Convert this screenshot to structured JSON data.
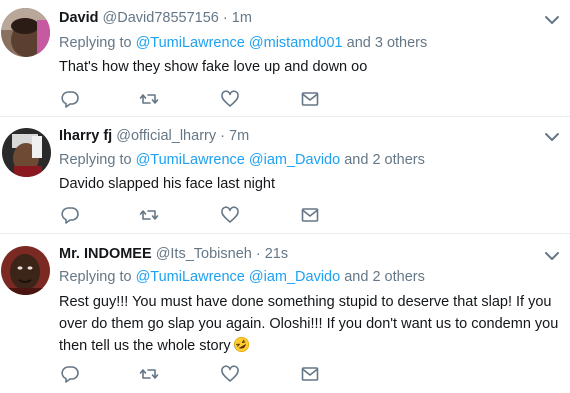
{
  "tweets": [
    {
      "name": "David",
      "handle": "@David78557156",
      "dot": "·",
      "time": "1m",
      "replying_prefix": "Replying to",
      "mention1": "@TumiLawrence",
      "mention2": "@mistamd001",
      "others": "and 3 others",
      "text": "That's how they show fake love up and down oo",
      "avatar_icon": "person-avatar-icon"
    },
    {
      "name": "Iharry fj",
      "handle": "@official_lharry",
      "dot": "·",
      "time": "7m",
      "replying_prefix": "Replying to",
      "mention1": "@TumiLawrence",
      "mention2": "@iam_Davido",
      "others": "and 2 others",
      "text": "Davido slapped his face last night",
      "avatar_icon": "person-avatar-icon"
    },
    {
      "name": "Mr. INDOMEE",
      "handle": "@Its_Tobisneh",
      "dot": "·",
      "time": "21s",
      "replying_prefix": "Replying to",
      "mention1": "@TumiLawrence",
      "mention2": "@iam_Davido",
      "others": "and 2 others",
      "text": "Rest guy!!! You must have done something stupid to deserve that slap! If you over do them go slap you again. Oloshi!!! If you don't want us to condemn you then tell us the whole story",
      "emoji": "rolling-on-floor-laughing-emoji",
      "avatar_icon": "person-avatar-icon"
    }
  ],
  "icons": {
    "reply": "reply-icon",
    "retweet": "retweet-icon",
    "like": "heart-icon",
    "dm": "envelope-icon",
    "menu": "chevron-down-icon"
  },
  "colors": {
    "link": "#1da1f2",
    "secondary_text": "#657786",
    "primary_text": "#14171a",
    "divider": "#e6ecf0"
  }
}
